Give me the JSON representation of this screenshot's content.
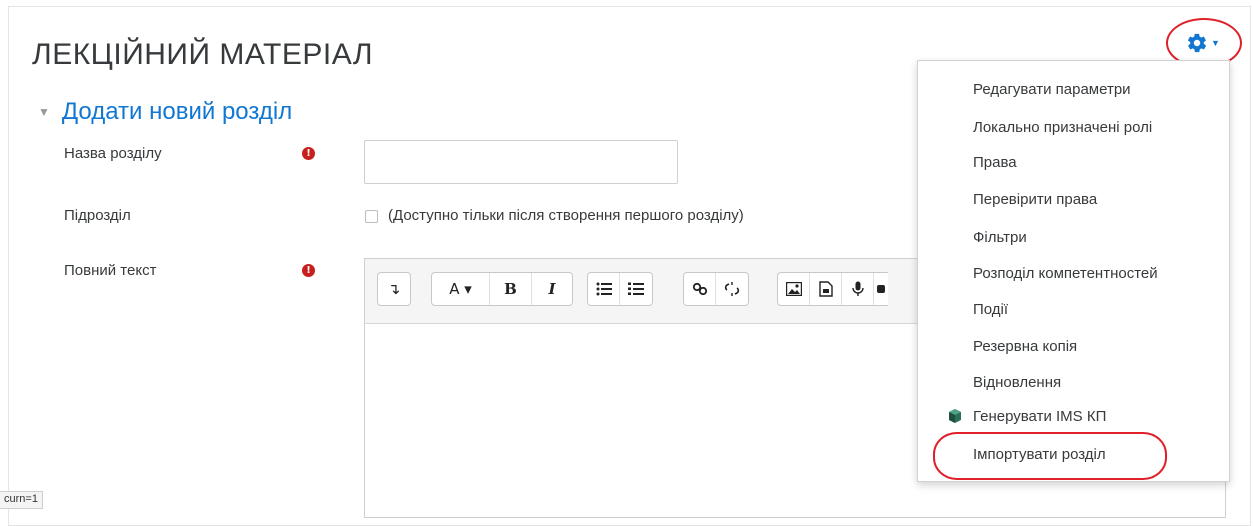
{
  "page": {
    "title": "ЛЕКЦІЙНИЙ МАТЕРІАЛ",
    "section_title": "Додати новий розділ",
    "section_toggle_icon": "triangle-down-icon"
  },
  "form": {
    "section_name_label": "Назва розділу",
    "section_name_value": "",
    "subsection_label": "Підрозділ",
    "subsection_checkbox_label": "(Доступно тільки після створення першого розділу)",
    "full_text_label": "Повний текст",
    "required_icon": "!"
  },
  "editor_toolbar": {
    "collapse": "↴",
    "font_style": "A ▾",
    "bold": "B",
    "italic": "I",
    "unordered_list": "☰",
    "ordered_list": "☷",
    "link": "🔗",
    "unlink": "✂"
  },
  "settings_menu": {
    "gear_icon": "gear-icon",
    "items": [
      "Редагувати параметри",
      "Локально призначені ролі",
      "Права",
      "Перевірити права",
      "Фільтри",
      "Розподіл компетентностей",
      "Події",
      "Резервна копія",
      "Відновлення",
      "Генерувати IMS КП",
      "Імпортувати розділ"
    ]
  },
  "status_bar": {
    "text": "curn=1"
  },
  "colors": {
    "accent": "#1177d1",
    "required": "#c81e1e",
    "highlight_circle": "#e0202a"
  }
}
